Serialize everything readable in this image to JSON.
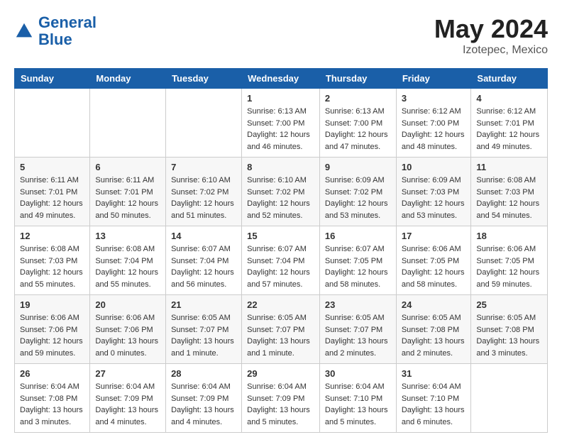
{
  "header": {
    "logo_general": "General",
    "logo_blue": "Blue",
    "month": "May 2024",
    "location": "Izotepec, Mexico"
  },
  "weekdays": [
    "Sunday",
    "Monday",
    "Tuesday",
    "Wednesday",
    "Thursday",
    "Friday",
    "Saturday"
  ],
  "weeks": [
    [
      {
        "day": "",
        "info": ""
      },
      {
        "day": "",
        "info": ""
      },
      {
        "day": "",
        "info": ""
      },
      {
        "day": "1",
        "info": "Sunrise: 6:13 AM\nSunset: 7:00 PM\nDaylight: 12 hours\nand 46 minutes."
      },
      {
        "day": "2",
        "info": "Sunrise: 6:13 AM\nSunset: 7:00 PM\nDaylight: 12 hours\nand 47 minutes."
      },
      {
        "day": "3",
        "info": "Sunrise: 6:12 AM\nSunset: 7:00 PM\nDaylight: 12 hours\nand 48 minutes."
      },
      {
        "day": "4",
        "info": "Sunrise: 6:12 AM\nSunset: 7:01 PM\nDaylight: 12 hours\nand 49 minutes."
      }
    ],
    [
      {
        "day": "5",
        "info": "Sunrise: 6:11 AM\nSunset: 7:01 PM\nDaylight: 12 hours\nand 49 minutes."
      },
      {
        "day": "6",
        "info": "Sunrise: 6:11 AM\nSunset: 7:01 PM\nDaylight: 12 hours\nand 50 minutes."
      },
      {
        "day": "7",
        "info": "Sunrise: 6:10 AM\nSunset: 7:02 PM\nDaylight: 12 hours\nand 51 minutes."
      },
      {
        "day": "8",
        "info": "Sunrise: 6:10 AM\nSunset: 7:02 PM\nDaylight: 12 hours\nand 52 minutes."
      },
      {
        "day": "9",
        "info": "Sunrise: 6:09 AM\nSunset: 7:02 PM\nDaylight: 12 hours\nand 53 minutes."
      },
      {
        "day": "10",
        "info": "Sunrise: 6:09 AM\nSunset: 7:03 PM\nDaylight: 12 hours\nand 53 minutes."
      },
      {
        "day": "11",
        "info": "Sunrise: 6:08 AM\nSunset: 7:03 PM\nDaylight: 12 hours\nand 54 minutes."
      }
    ],
    [
      {
        "day": "12",
        "info": "Sunrise: 6:08 AM\nSunset: 7:03 PM\nDaylight: 12 hours\nand 55 minutes."
      },
      {
        "day": "13",
        "info": "Sunrise: 6:08 AM\nSunset: 7:04 PM\nDaylight: 12 hours\nand 55 minutes."
      },
      {
        "day": "14",
        "info": "Sunrise: 6:07 AM\nSunset: 7:04 PM\nDaylight: 12 hours\nand 56 minutes."
      },
      {
        "day": "15",
        "info": "Sunrise: 6:07 AM\nSunset: 7:04 PM\nDaylight: 12 hours\nand 57 minutes."
      },
      {
        "day": "16",
        "info": "Sunrise: 6:07 AM\nSunset: 7:05 PM\nDaylight: 12 hours\nand 58 minutes."
      },
      {
        "day": "17",
        "info": "Sunrise: 6:06 AM\nSunset: 7:05 PM\nDaylight: 12 hours\nand 58 minutes."
      },
      {
        "day": "18",
        "info": "Sunrise: 6:06 AM\nSunset: 7:05 PM\nDaylight: 12 hours\nand 59 minutes."
      }
    ],
    [
      {
        "day": "19",
        "info": "Sunrise: 6:06 AM\nSunset: 7:06 PM\nDaylight: 12 hours\nand 59 minutes."
      },
      {
        "day": "20",
        "info": "Sunrise: 6:06 AM\nSunset: 7:06 PM\nDaylight: 13 hours\nand 0 minutes."
      },
      {
        "day": "21",
        "info": "Sunrise: 6:05 AM\nSunset: 7:07 PM\nDaylight: 13 hours\nand 1 minute."
      },
      {
        "day": "22",
        "info": "Sunrise: 6:05 AM\nSunset: 7:07 PM\nDaylight: 13 hours\nand 1 minute."
      },
      {
        "day": "23",
        "info": "Sunrise: 6:05 AM\nSunset: 7:07 PM\nDaylight: 13 hours\nand 2 minutes."
      },
      {
        "day": "24",
        "info": "Sunrise: 6:05 AM\nSunset: 7:08 PM\nDaylight: 13 hours\nand 2 minutes."
      },
      {
        "day": "25",
        "info": "Sunrise: 6:05 AM\nSunset: 7:08 PM\nDaylight: 13 hours\nand 3 minutes."
      }
    ],
    [
      {
        "day": "26",
        "info": "Sunrise: 6:04 AM\nSunset: 7:08 PM\nDaylight: 13 hours\nand 3 minutes."
      },
      {
        "day": "27",
        "info": "Sunrise: 6:04 AM\nSunset: 7:09 PM\nDaylight: 13 hours\nand 4 minutes."
      },
      {
        "day": "28",
        "info": "Sunrise: 6:04 AM\nSunset: 7:09 PM\nDaylight: 13 hours\nand 4 minutes."
      },
      {
        "day": "29",
        "info": "Sunrise: 6:04 AM\nSunset: 7:09 PM\nDaylight: 13 hours\nand 5 minutes."
      },
      {
        "day": "30",
        "info": "Sunrise: 6:04 AM\nSunset: 7:10 PM\nDaylight: 13 hours\nand 5 minutes."
      },
      {
        "day": "31",
        "info": "Sunrise: 6:04 AM\nSunset: 7:10 PM\nDaylight: 13 hours\nand 6 minutes."
      },
      {
        "day": "",
        "info": ""
      }
    ]
  ]
}
